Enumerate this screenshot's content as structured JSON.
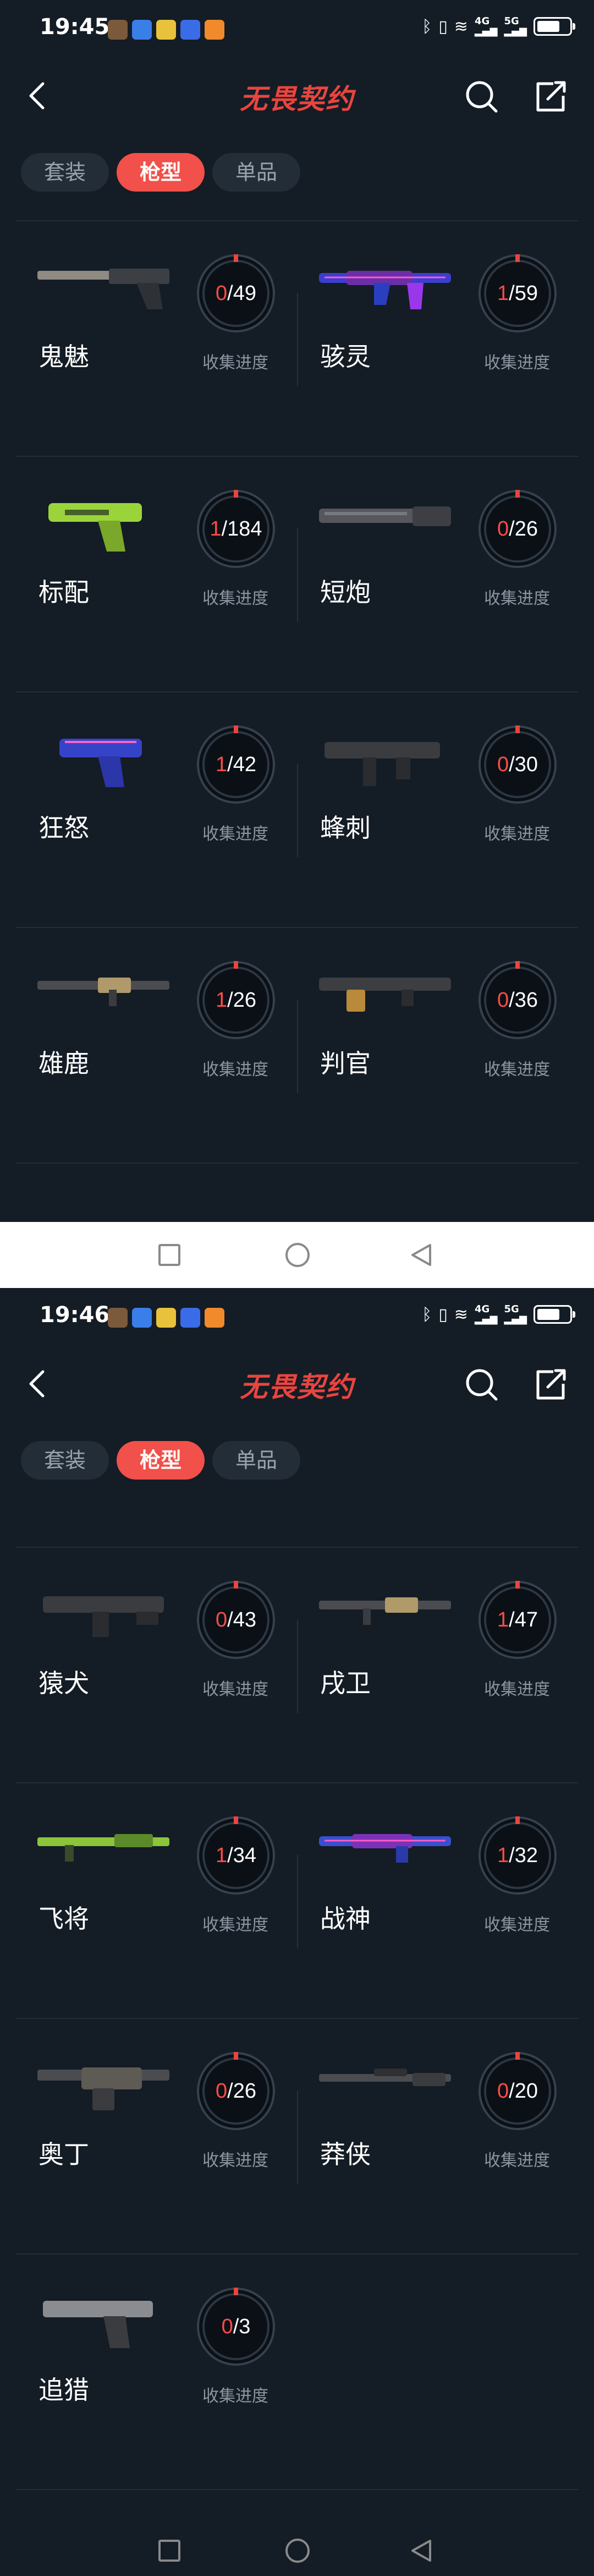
{
  "app": {
    "logo_text": "无畏契约",
    "tabs": [
      "套装",
      "枪型",
      "单品"
    ],
    "active_tab": "枪型",
    "progress_label": "收集进度"
  },
  "screenshots": [
    {
      "time": "19:45",
      "items": [
        {
          "name": "鬼魅",
          "got": "0",
          "total": "49"
        },
        {
          "name": "骇灵",
          "got": "1",
          "total": "59"
        },
        {
          "name": "标配",
          "got": "1",
          "total": "184"
        },
        {
          "name": "短炮",
          "got": "0",
          "total": "26"
        },
        {
          "name": "狂怒",
          "got": "1",
          "total": "42"
        },
        {
          "name": "蜂刺",
          "got": "0",
          "total": "30"
        },
        {
          "name": "雄鹿",
          "got": "1",
          "total": "26"
        },
        {
          "name": "判官",
          "got": "0",
          "total": "36"
        }
      ]
    },
    {
      "time": "19:46",
      "items": [
        {
          "name": "猿犬",
          "got": "0",
          "total": "43"
        },
        {
          "name": "戌卫",
          "got": "1",
          "total": "47"
        },
        {
          "name": "飞将",
          "got": "1",
          "total": "34"
        },
        {
          "name": "战神",
          "got": "1",
          "total": "32"
        },
        {
          "name": "奥丁",
          "got": "0",
          "total": "26"
        },
        {
          "name": "莽侠",
          "got": "0",
          "total": "20"
        },
        {
          "name": "追猎",
          "got": "0",
          "total": "3"
        }
      ]
    }
  ],
  "colors": {
    "background": "#141c25",
    "accent": "#f2504a",
    "progress_text": "#ff4c46"
  }
}
